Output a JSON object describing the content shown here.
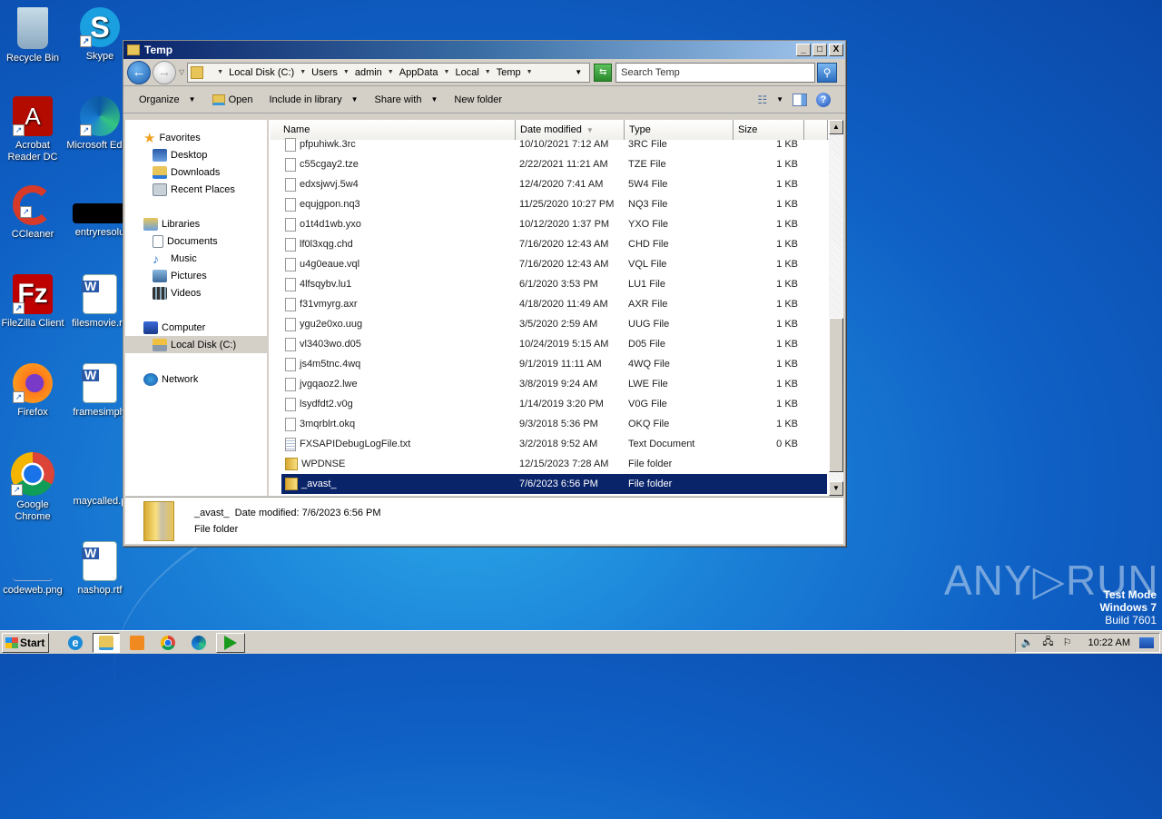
{
  "desktop": {
    "icons": [
      {
        "label": "Recycle Bin",
        "icon": "recycle-bin-icon"
      },
      {
        "label": "Skype",
        "icon": "skype-icon"
      },
      {
        "label": "Acrobat Reader DC",
        "icon": "acrobat-icon"
      },
      {
        "label": "Microsoft Edge",
        "icon": "edge-icon"
      },
      {
        "label": "CCleaner",
        "icon": "ccleaner-icon"
      },
      {
        "label": "entryresolu",
        "icon": "file-icon"
      },
      {
        "label": "FileZilla Client",
        "icon": "filezilla-icon"
      },
      {
        "label": "filesmovie.rtf",
        "icon": "word-doc-icon"
      },
      {
        "label": "Firefox",
        "icon": "firefox-icon"
      },
      {
        "label": "framesimply",
        "icon": "word-doc-icon"
      },
      {
        "label": "Google Chrome",
        "icon": "chrome-icon"
      },
      {
        "label": "maycalled.p",
        "icon": "file-icon"
      },
      {
        "label": "codeweb.png",
        "icon": "image-icon"
      },
      {
        "label": "nashop.rtf",
        "icon": "word-doc-icon"
      }
    ]
  },
  "window": {
    "title": "Temp",
    "controls": {
      "minimize": "_",
      "maximize": "□",
      "close": "X"
    },
    "breadcrumb": [
      "Local Disk (C:)",
      "Users",
      "admin",
      "AppData",
      "Local",
      "Temp"
    ],
    "search_placeholder": "Search Temp",
    "toolbar": {
      "organize": "Organize",
      "open": "Open",
      "include_in_library": "Include in library",
      "share_with": "Share with",
      "new_folder": "New folder"
    },
    "nav": {
      "favorites": "Favorites",
      "desktop": "Desktop",
      "downloads": "Downloads",
      "recent_places": "Recent Places",
      "libraries": "Libraries",
      "documents": "Documents",
      "music": "Music",
      "pictures": "Pictures",
      "videos": "Videos",
      "computer": "Computer",
      "local_disk": "Local Disk (C:)",
      "network": "Network"
    },
    "columns": {
      "name": "Name",
      "date": "Date modified",
      "type": "Type",
      "size": "Size"
    },
    "files": [
      {
        "name": "pfpuhiwk.3rc",
        "date": "10/10/2021 7:12 AM",
        "type": "3RC File",
        "size": "1 KB",
        "kind": "file"
      },
      {
        "name": "c55cgay2.tze",
        "date": "2/22/2021 11:21 AM",
        "type": "TZE File",
        "size": "1 KB",
        "kind": "file"
      },
      {
        "name": "edxsjwvj.5w4",
        "date": "12/4/2020 7:41 AM",
        "type": "5W4 File",
        "size": "1 KB",
        "kind": "file"
      },
      {
        "name": "equjgpon.nq3",
        "date": "11/25/2020 10:27 PM",
        "type": "NQ3 File",
        "size": "1 KB",
        "kind": "file"
      },
      {
        "name": "o1t4d1wb.yxo",
        "date": "10/12/2020 1:37 PM",
        "type": "YXO File",
        "size": "1 KB",
        "kind": "file"
      },
      {
        "name": "lf0l3xqg.chd",
        "date": "7/16/2020 12:43 AM",
        "type": "CHD File",
        "size": "1 KB",
        "kind": "file"
      },
      {
        "name": "u4g0eaue.vql",
        "date": "7/16/2020 12:43 AM",
        "type": "VQL File",
        "size": "1 KB",
        "kind": "file"
      },
      {
        "name": "4lfsqybv.lu1",
        "date": "6/1/2020 3:53 PM",
        "type": "LU1 File",
        "size": "1 KB",
        "kind": "file"
      },
      {
        "name": "f31vmyrg.axr",
        "date": "4/18/2020 11:49 AM",
        "type": "AXR File",
        "size": "1 KB",
        "kind": "file"
      },
      {
        "name": "ygu2e0xo.uug",
        "date": "3/5/2020 2:59 AM",
        "type": "UUG File",
        "size": "1 KB",
        "kind": "file"
      },
      {
        "name": "vl3403wo.d05",
        "date": "10/24/2019 5:15 AM",
        "type": "D05 File",
        "size": "1 KB",
        "kind": "file"
      },
      {
        "name": "js4m5tnc.4wq",
        "date": "9/1/2019 11:11 AM",
        "type": "4WQ File",
        "size": "1 KB",
        "kind": "file"
      },
      {
        "name": "jvgqaoz2.lwe",
        "date": "3/8/2019 9:24 AM",
        "type": "LWE File",
        "size": "1 KB",
        "kind": "file"
      },
      {
        "name": "lsydfdt2.v0g",
        "date": "1/14/2019 3:20 PM",
        "type": "V0G File",
        "size": "1 KB",
        "kind": "file"
      },
      {
        "name": "3mqrblrt.okq",
        "date": "9/3/2018 5:36 PM",
        "type": "OKQ File",
        "size": "1 KB",
        "kind": "file"
      },
      {
        "name": "FXSAPIDebugLogFile.txt",
        "date": "3/2/2018 9:52 AM",
        "type": "Text Document",
        "size": "0 KB",
        "kind": "txt"
      },
      {
        "name": "WPDNSE",
        "date": "12/15/2023 7:28 AM",
        "type": "File folder",
        "size": "",
        "kind": "folder"
      },
      {
        "name": "_avast_",
        "date": "7/6/2023 6:56 PM",
        "type": "File folder",
        "size": "",
        "kind": "folder",
        "selected": true
      }
    ],
    "details": {
      "name": "_avast_",
      "date_label": "Date modified:",
      "date": "7/6/2023 6:56 PM",
      "type": "File folder"
    }
  },
  "watermark": {
    "brand": "ANY▷RUN",
    "line1": "Test Mode",
    "line2": "Windows 7",
    "line3": "Build 7601"
  },
  "taskbar": {
    "start": "Start",
    "apps": [
      "internet-explorer-icon",
      "explorer-icon",
      "media-player-icon",
      "chrome-icon",
      "edge-icon",
      "anyrun-icon"
    ],
    "clock": "10:22 AM"
  }
}
